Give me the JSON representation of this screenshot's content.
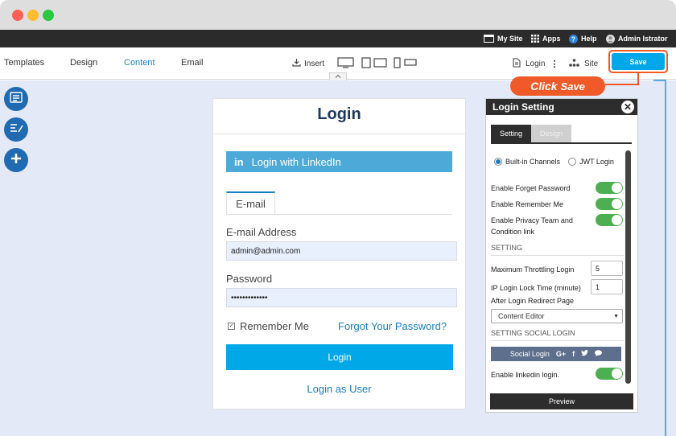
{
  "admin_bar": {
    "my_site": "My Site",
    "apps": "Apps",
    "help": "Help",
    "user": "Admin Istrator"
  },
  "toolbar": {
    "tabs": [
      "Templates",
      "Design",
      "Content",
      "Email"
    ],
    "active_tab": "Content",
    "insert": "Insert",
    "page_selector": "Login",
    "site": "Site",
    "save": "Save"
  },
  "callout": {
    "word1": "Click",
    "word2": "Save"
  },
  "login_card": {
    "title": "Login",
    "linkedin_icon": "in",
    "linkedin_label": "Login with LinkedIn",
    "email_tab": "E-mail",
    "email_label": "E-mail Address",
    "email_value": "admin@admin.com",
    "password_label": "Password",
    "password_value": "•••••••••••••",
    "remember_me": "Remember Me",
    "forgot": "Forgot Your Password?",
    "login_button": "Login",
    "login_as_user": "Login as User"
  },
  "panel": {
    "title": "Login Setting",
    "tab_setting": "Setting",
    "tab_design": "Design",
    "radio_builtin": "Built-in Channels",
    "radio_jwt": "JWT Login",
    "toggle_forget": "Enable Forget Password",
    "toggle_remember": "Enable Remember Me",
    "toggle_privacy": "Enable Privacy Team and Condition link",
    "section_setting": "SETTING",
    "max_throttling_label": "Maximum Throttling Login",
    "max_throttling_value": "5",
    "ip_lock_label": "IP Login Lock Time (minute)",
    "ip_lock_value": "1",
    "redirect_label": "After Login Redirect Page",
    "redirect_value": "Content Editor",
    "section_social": "SETTING SOCIAL LOGIN",
    "social_login": "Social Login",
    "enable_linkedin": "Enable linkedin login.",
    "preview": "Preview"
  },
  "colors": {
    "accent": "#00a8e8",
    "brand_dark": "#2d2d2d",
    "callout": "#f05a28",
    "toggle_on": "#4caf50",
    "canvas": "#e3e9f6",
    "link": "#1a7fc1"
  },
  "icons": {
    "my_site": "browser-window-icon",
    "apps": "grid-icon",
    "help": "help-circle-icon",
    "user": "user-avatar-icon",
    "insert": "download-icon",
    "login_page": "document-icon",
    "site": "sitemap-icon",
    "close": "close-icon"
  }
}
